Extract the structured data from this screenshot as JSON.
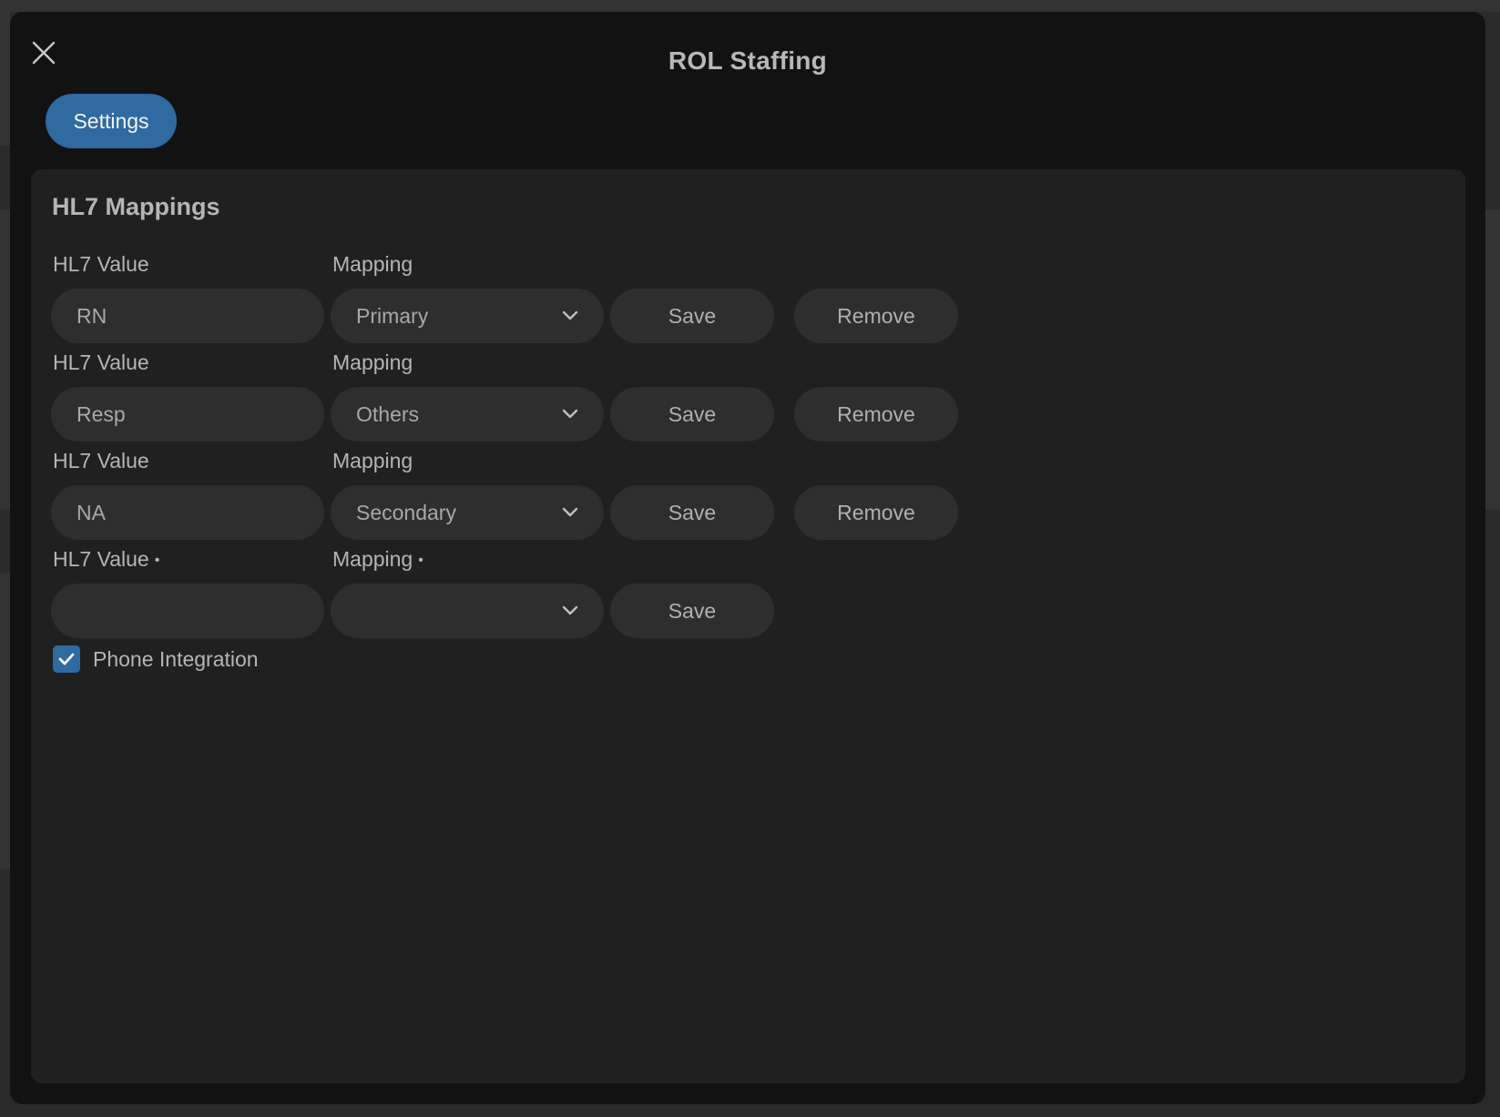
{
  "modal": {
    "title": "ROL Staffing",
    "tabs": [
      {
        "label": "Settings",
        "active": true
      }
    ]
  },
  "hl7": {
    "section_title": "HL7 Mappings",
    "rows": [
      {
        "value_label": "HL7 Value",
        "mapping_label": "Mapping",
        "value": "RN",
        "mapping": "Primary",
        "save_label": "Save",
        "remove_label": "Remove"
      },
      {
        "value_label": "HL7 Value",
        "mapping_label": "Mapping",
        "value": "Resp",
        "mapping": "Others",
        "save_label": "Save",
        "remove_label": "Remove"
      },
      {
        "value_label": "HL7 Value",
        "mapping_label": "Mapping",
        "value": "NA",
        "mapping": "Secondary",
        "save_label": "Save",
        "remove_label": "Remove"
      }
    ],
    "new_row": {
      "value_label": "HL7 Value",
      "mapping_label": "Mapping",
      "required_marker": "•",
      "value": "",
      "mapping": "",
      "save_label": "Save"
    }
  },
  "phone_integration": {
    "label": "Phone Integration",
    "checked": true
  },
  "colors": {
    "accent": "#2f6aa0",
    "modal_bg": "#121212",
    "panel_bg": "#202020",
    "field_bg": "#2e2e2e"
  },
  "icons": {
    "close": "close-icon",
    "dropdown": "chevron-down-icon",
    "check": "checkmark-icon"
  }
}
